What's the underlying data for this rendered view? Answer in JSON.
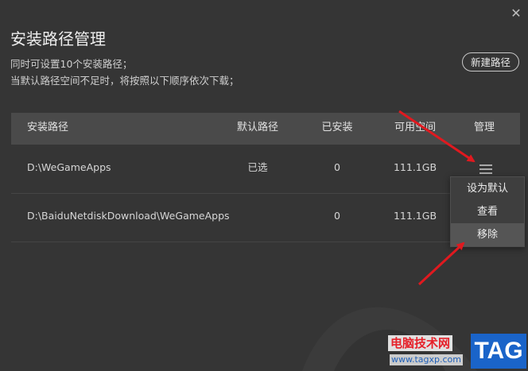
{
  "dialog": {
    "title": "安装路径管理",
    "desc_line1": "同时可设置10个安装路径；",
    "desc_line2": "当默认路径空间不足时，将按照以下顺序依次下载；",
    "new_path_label": "新建路径",
    "close_glyph": "✕"
  },
  "table": {
    "headers": {
      "path": "安装路径",
      "default": "默认路径",
      "installed": "已安装",
      "space": "可用空间",
      "manage": "管理"
    },
    "rows": [
      {
        "path": "D:\\WeGameApps",
        "default": "已选",
        "installed": "0",
        "space": "111.1GB"
      },
      {
        "path": "D:\\BaiduNetdiskDownload\\WeGameApps",
        "default": "",
        "installed": "0",
        "space": "111.1GB"
      }
    ]
  },
  "popup": {
    "items": [
      "设为默认",
      "查看",
      "移除"
    ]
  },
  "watermark": {
    "cn": "电脑技术网",
    "url": "www.tagxp.com",
    "tag": "TAG"
  },
  "colors": {
    "background": "#353535",
    "header_bg": "#4a4a4a",
    "arrow": "#e0191f",
    "tag_blue": "#1a64c9"
  }
}
